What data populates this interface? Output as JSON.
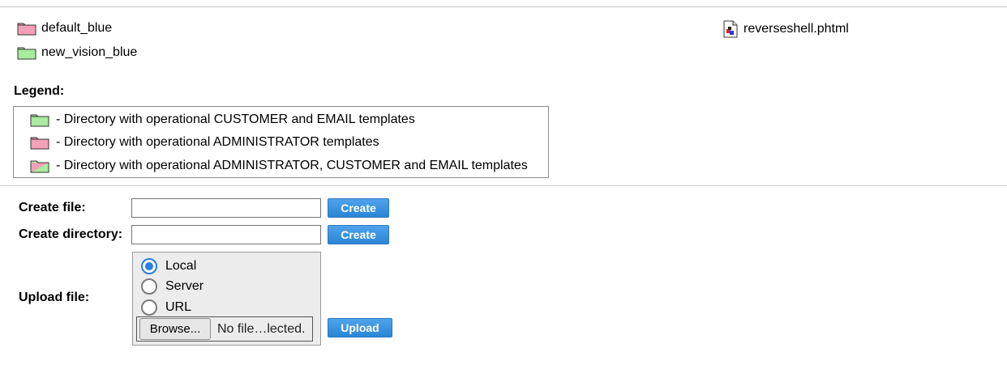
{
  "file_list": {
    "folders": [
      {
        "name": "default_blue",
        "color": "#f4a0b8"
      },
      {
        "name": "new_vision_blue",
        "color": "#a8ec9e"
      }
    ],
    "files": [
      {
        "name": "reverseshell.phtml"
      }
    ]
  },
  "legend": {
    "title": "Legend:",
    "items": [
      {
        "text": "- Directory with operational CUSTOMER and EMAIL templates",
        "color": "#a8ec9e"
      },
      {
        "text": "- Directory with operational ADMINISTRATOR templates",
        "color": "#f4a0b8"
      },
      {
        "text": "- Directory with operational ADMINISTRATOR, CUSTOMER and EMAIL templates",
        "color": "mixed"
      }
    ]
  },
  "forms": {
    "create_file": {
      "label": "Create file:",
      "value": "",
      "button": "Create"
    },
    "create_directory": {
      "label": "Create directory:",
      "value": "",
      "button": "Create"
    },
    "upload": {
      "label": "Upload file:",
      "options": [
        "Local",
        "Server",
        "URL"
      ],
      "selected": "Local",
      "browse_label": "Browse...",
      "no_file_text": "No file…lected.",
      "button": "Upload"
    }
  },
  "colors": {
    "accent_button": "#2a86d6",
    "radio_selected": "#2a7be4"
  }
}
